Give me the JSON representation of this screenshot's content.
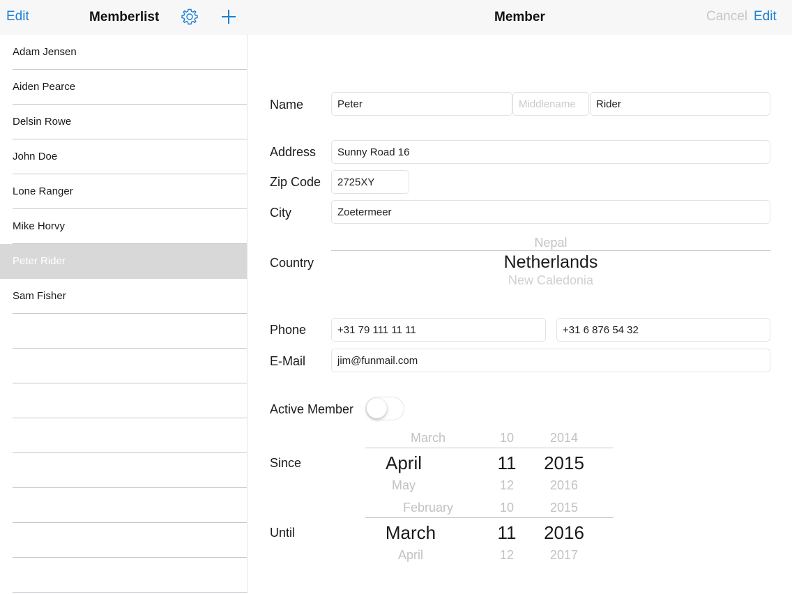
{
  "master_nav": {
    "edit_label": "Edit",
    "title": "Memberlist",
    "settings_icon": "gear-icon",
    "add_icon": "plus-icon"
  },
  "detail_nav": {
    "title": "Member",
    "cancel_label": "Cancel",
    "edit_label": "Edit"
  },
  "members": [
    "Adam Jensen",
    "Aiden Pearce",
    "Delsin Rowe",
    "John Doe",
    "Lone Ranger",
    "Mike Horvy",
    "Peter Rider",
    "Sam Fisher"
  ],
  "selected_member": "Peter Rider",
  "form": {
    "name_label": "Name",
    "first_name": "Peter",
    "middle_name": "",
    "middle_placeholder": "Middlename",
    "last_name": "Rider",
    "address_label": "Address",
    "address": "Sunny Road 16",
    "zip_label": "Zip Code",
    "zip": "2725XY",
    "city_label": "City",
    "city": "Zoetermeer",
    "country_label": "Country",
    "country_prev": "Nepal",
    "country_selected": "Netherlands",
    "country_next": "New Caledonia",
    "phone_label": "Phone",
    "phone1": "+31 79 111 11 11",
    "phone2": "+31 6 876 54 32",
    "email_label": "E-Mail",
    "email": "jim@funmail.com",
    "active_label": "Active Member",
    "active": false,
    "since_label": "Since",
    "since": {
      "prev": [
        "March",
        "10",
        "2014"
      ],
      "selected": [
        "April",
        "11",
        "2015"
      ],
      "next": [
        "May",
        "12",
        "2016"
      ]
    },
    "until_label": "Until",
    "until": {
      "prev": [
        "February",
        "10",
        "2015"
      ],
      "selected": [
        "March",
        "11",
        "2016"
      ],
      "next": [
        "April",
        "12",
        "2017"
      ]
    }
  },
  "colors": {
    "accent": "#1a7fd6",
    "disabled": "#c7c7cc",
    "selected_row": "#d8d8d8",
    "bar_bg": "#f7f7f7"
  }
}
